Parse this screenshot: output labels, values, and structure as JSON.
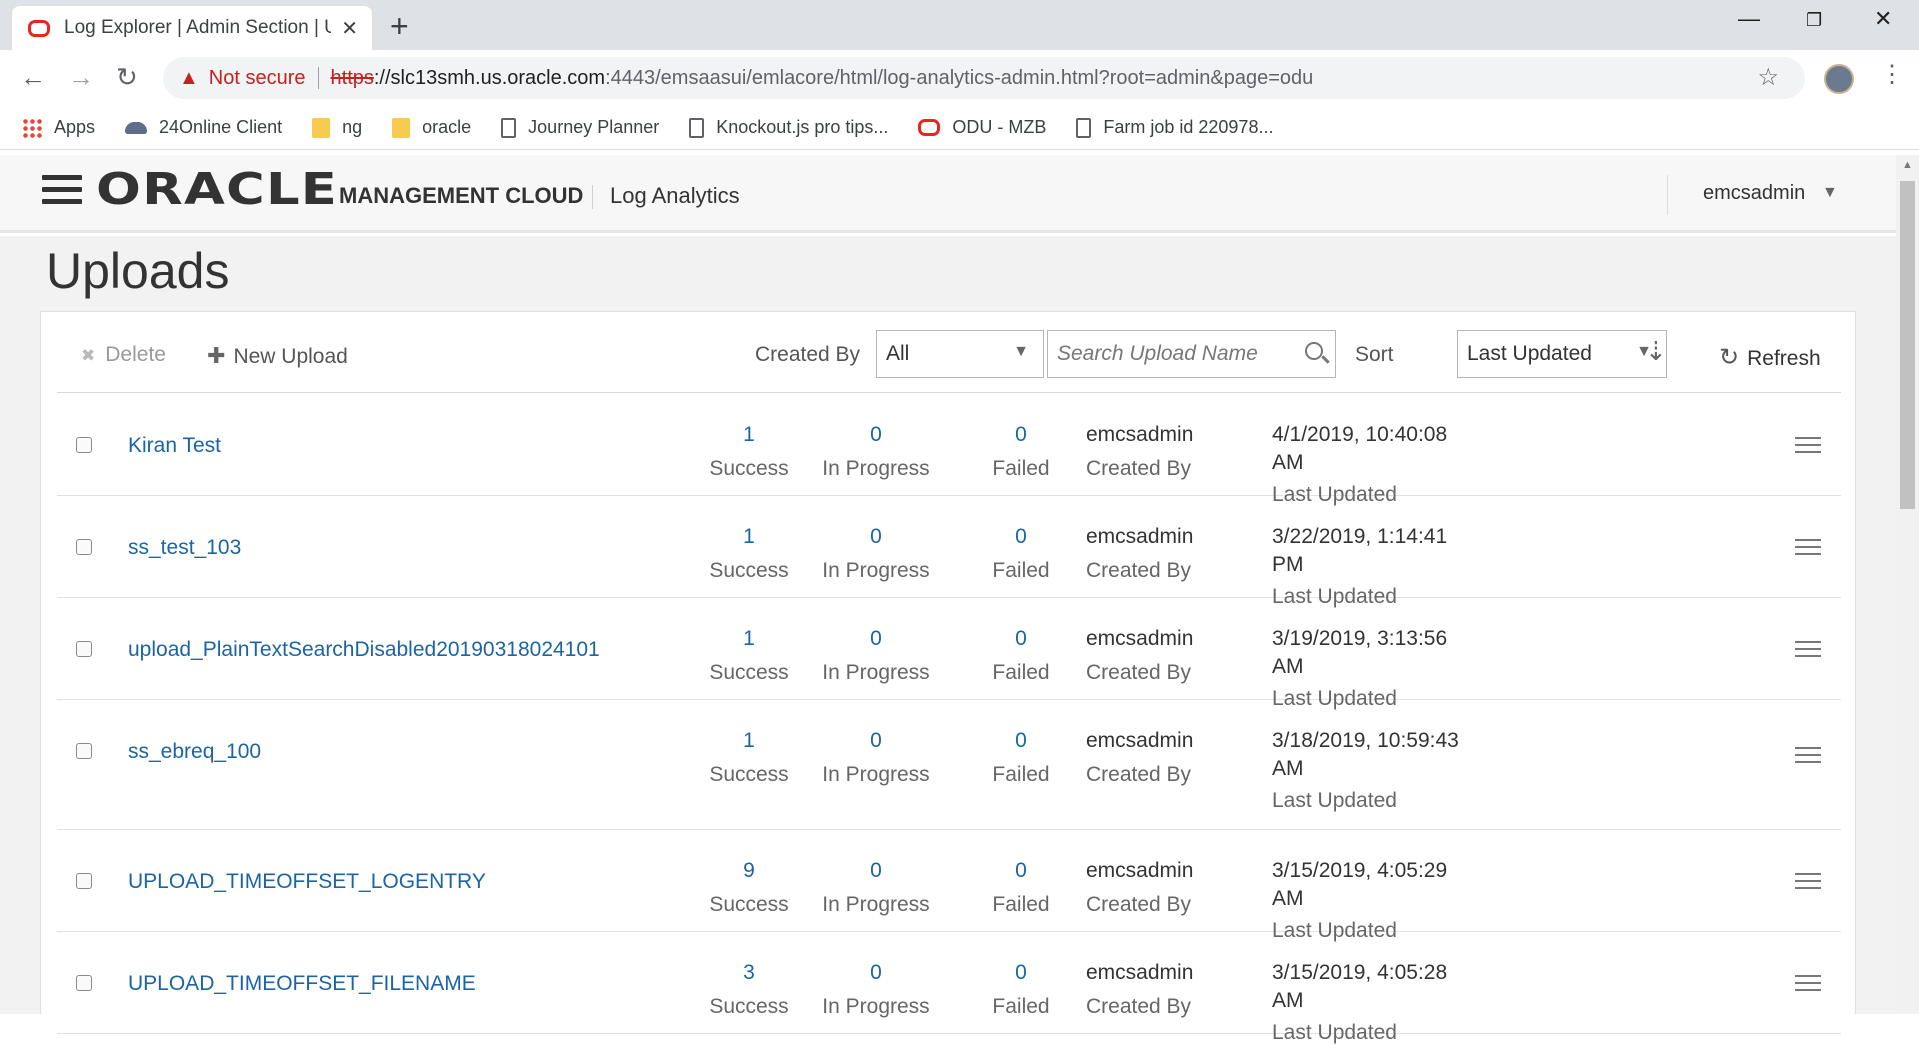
{
  "browser": {
    "tab_title": "Log Explorer | Admin Section | Up",
    "new_tab": "+",
    "security_label": "Not secure",
    "url_scheme": "https",
    "url_host": "://slc13smh.us.oracle.com",
    "url_rest": ":4443/emsaasui/emlacore/html/log-analytics-admin.html?root=admin&page=odu",
    "bookmarks": [
      {
        "label": "Apps",
        "icon": "apps-icon"
      },
      {
        "label": "24Online Client",
        "icon": "cloud-icon"
      },
      {
        "label": "ng",
        "icon": "folder-icon"
      },
      {
        "label": "oracle",
        "icon": "folder-icon"
      },
      {
        "label": "Journey Planner",
        "icon": "page-icon"
      },
      {
        "label": "Knockout.js pro tips...",
        "icon": "page-icon"
      },
      {
        "label": "ODU - MZB",
        "icon": "oracle-ring-icon"
      },
      {
        "label": "Farm job id 220978...",
        "icon": "page-icon"
      }
    ]
  },
  "header": {
    "logo": "ORACLE",
    "brand": "MANAGEMENT CLOUD",
    "product": "Log Analytics",
    "user": "emcsadmin"
  },
  "page": {
    "title": "Uploads"
  },
  "toolbar": {
    "delete_label": "Delete",
    "new_upload_label": "New Upload",
    "created_by_label": "Created By",
    "created_by_value": "All",
    "search_placeholder": "Search Upload Name",
    "sort_label": "Sort",
    "sort_value": "Last Updated",
    "refresh_label": "Refresh"
  },
  "labels": {
    "success": "Success",
    "in_progress": "In Progress",
    "failed": "Failed",
    "created_by": "Created By",
    "last_updated": "Last Updated"
  },
  "uploads": [
    {
      "name": "Kiran Test",
      "success": "1",
      "in_progress": "0",
      "failed": "0",
      "created_by": "emcsadmin",
      "last_updated": "4/1/2019, 10:40:08 AM"
    },
    {
      "name": "ss_test_103",
      "success": "1",
      "in_progress": "0",
      "failed": "0",
      "created_by": "emcsadmin",
      "last_updated": "3/22/2019, 1:14:41 PM"
    },
    {
      "name": "upload_PlainTextSearchDisabled20190318024101",
      "success": "1",
      "in_progress": "0",
      "failed": "0",
      "created_by": "emcsadmin",
      "last_updated": "3/19/2019, 3:13:56 AM"
    },
    {
      "name": "ss_ebreq_100",
      "success": "1",
      "in_progress": "0",
      "failed": "0",
      "created_by": "emcsadmin",
      "last_updated": "3/18/2019, 10:59:43 AM"
    },
    {
      "name": "UPLOAD_TIMEOFFSET_LOGENTRY",
      "success": "9",
      "in_progress": "0",
      "failed": "0",
      "created_by": "emcsadmin",
      "last_updated": "3/15/2019, 4:05:29 AM"
    },
    {
      "name": "UPLOAD_TIMEOFFSET_FILENAME",
      "success": "3",
      "in_progress": "0",
      "failed": "0",
      "created_by": "emcsadmin",
      "last_updated": "3/15/2019, 4:05:28 AM"
    }
  ]
}
